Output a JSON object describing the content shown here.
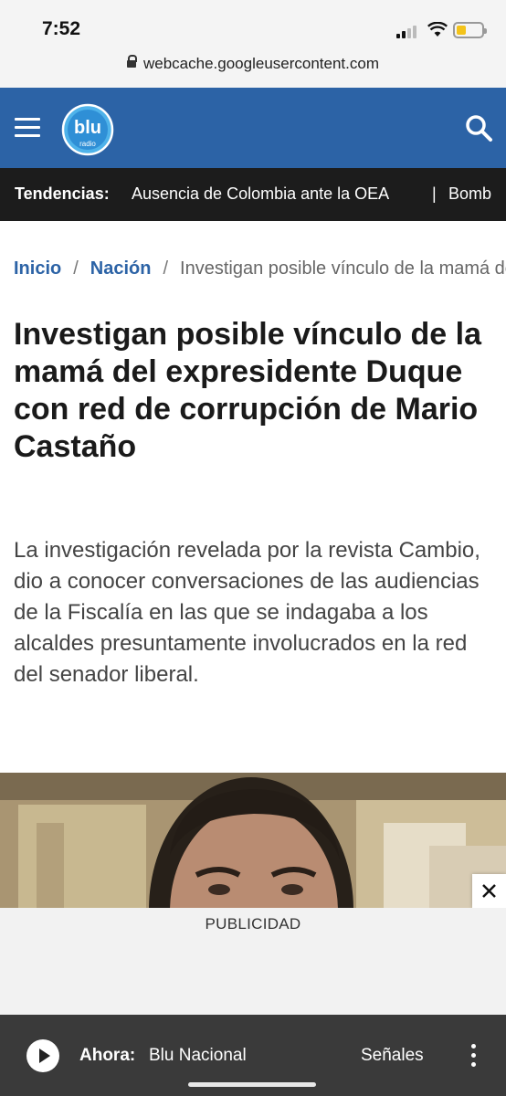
{
  "status_bar": {
    "time": "7:52"
  },
  "browser": {
    "url": "webcache.googleusercontent.com"
  },
  "header": {
    "logo_main": "blu",
    "logo_sub": "radio",
    "brand_color": "#2c63a6"
  },
  "trending": {
    "label": "Tendencias:",
    "item1": "Ausencia de Colombia ante la OEA",
    "separator": "|",
    "item2": "Bomb"
  },
  "breadcrumb": {
    "home": "Inicio",
    "section": "Nación",
    "sep": "/",
    "current": "Investigan posible vínculo de la mamá del expresidente Duque con red de corrupción de Mario Castaño"
  },
  "article": {
    "title": "Investigan posible vínculo de la mamá del expresidente Duque con red de corrupción de Mario Castaño",
    "lead": "La investigación revelada por la revista Cambio, dio a conocer conversaciones de las audiencias de la Fiscalía en las que se indagaba a los alcaldes presuntamente involucrados en la red del senador liberal."
  },
  "ad": {
    "label": "PUBLICIDAD",
    "close_icon": "close-icon"
  },
  "player": {
    "now_label": "Ahora:",
    "station": "Blu Nacional",
    "signals": "Señales"
  }
}
